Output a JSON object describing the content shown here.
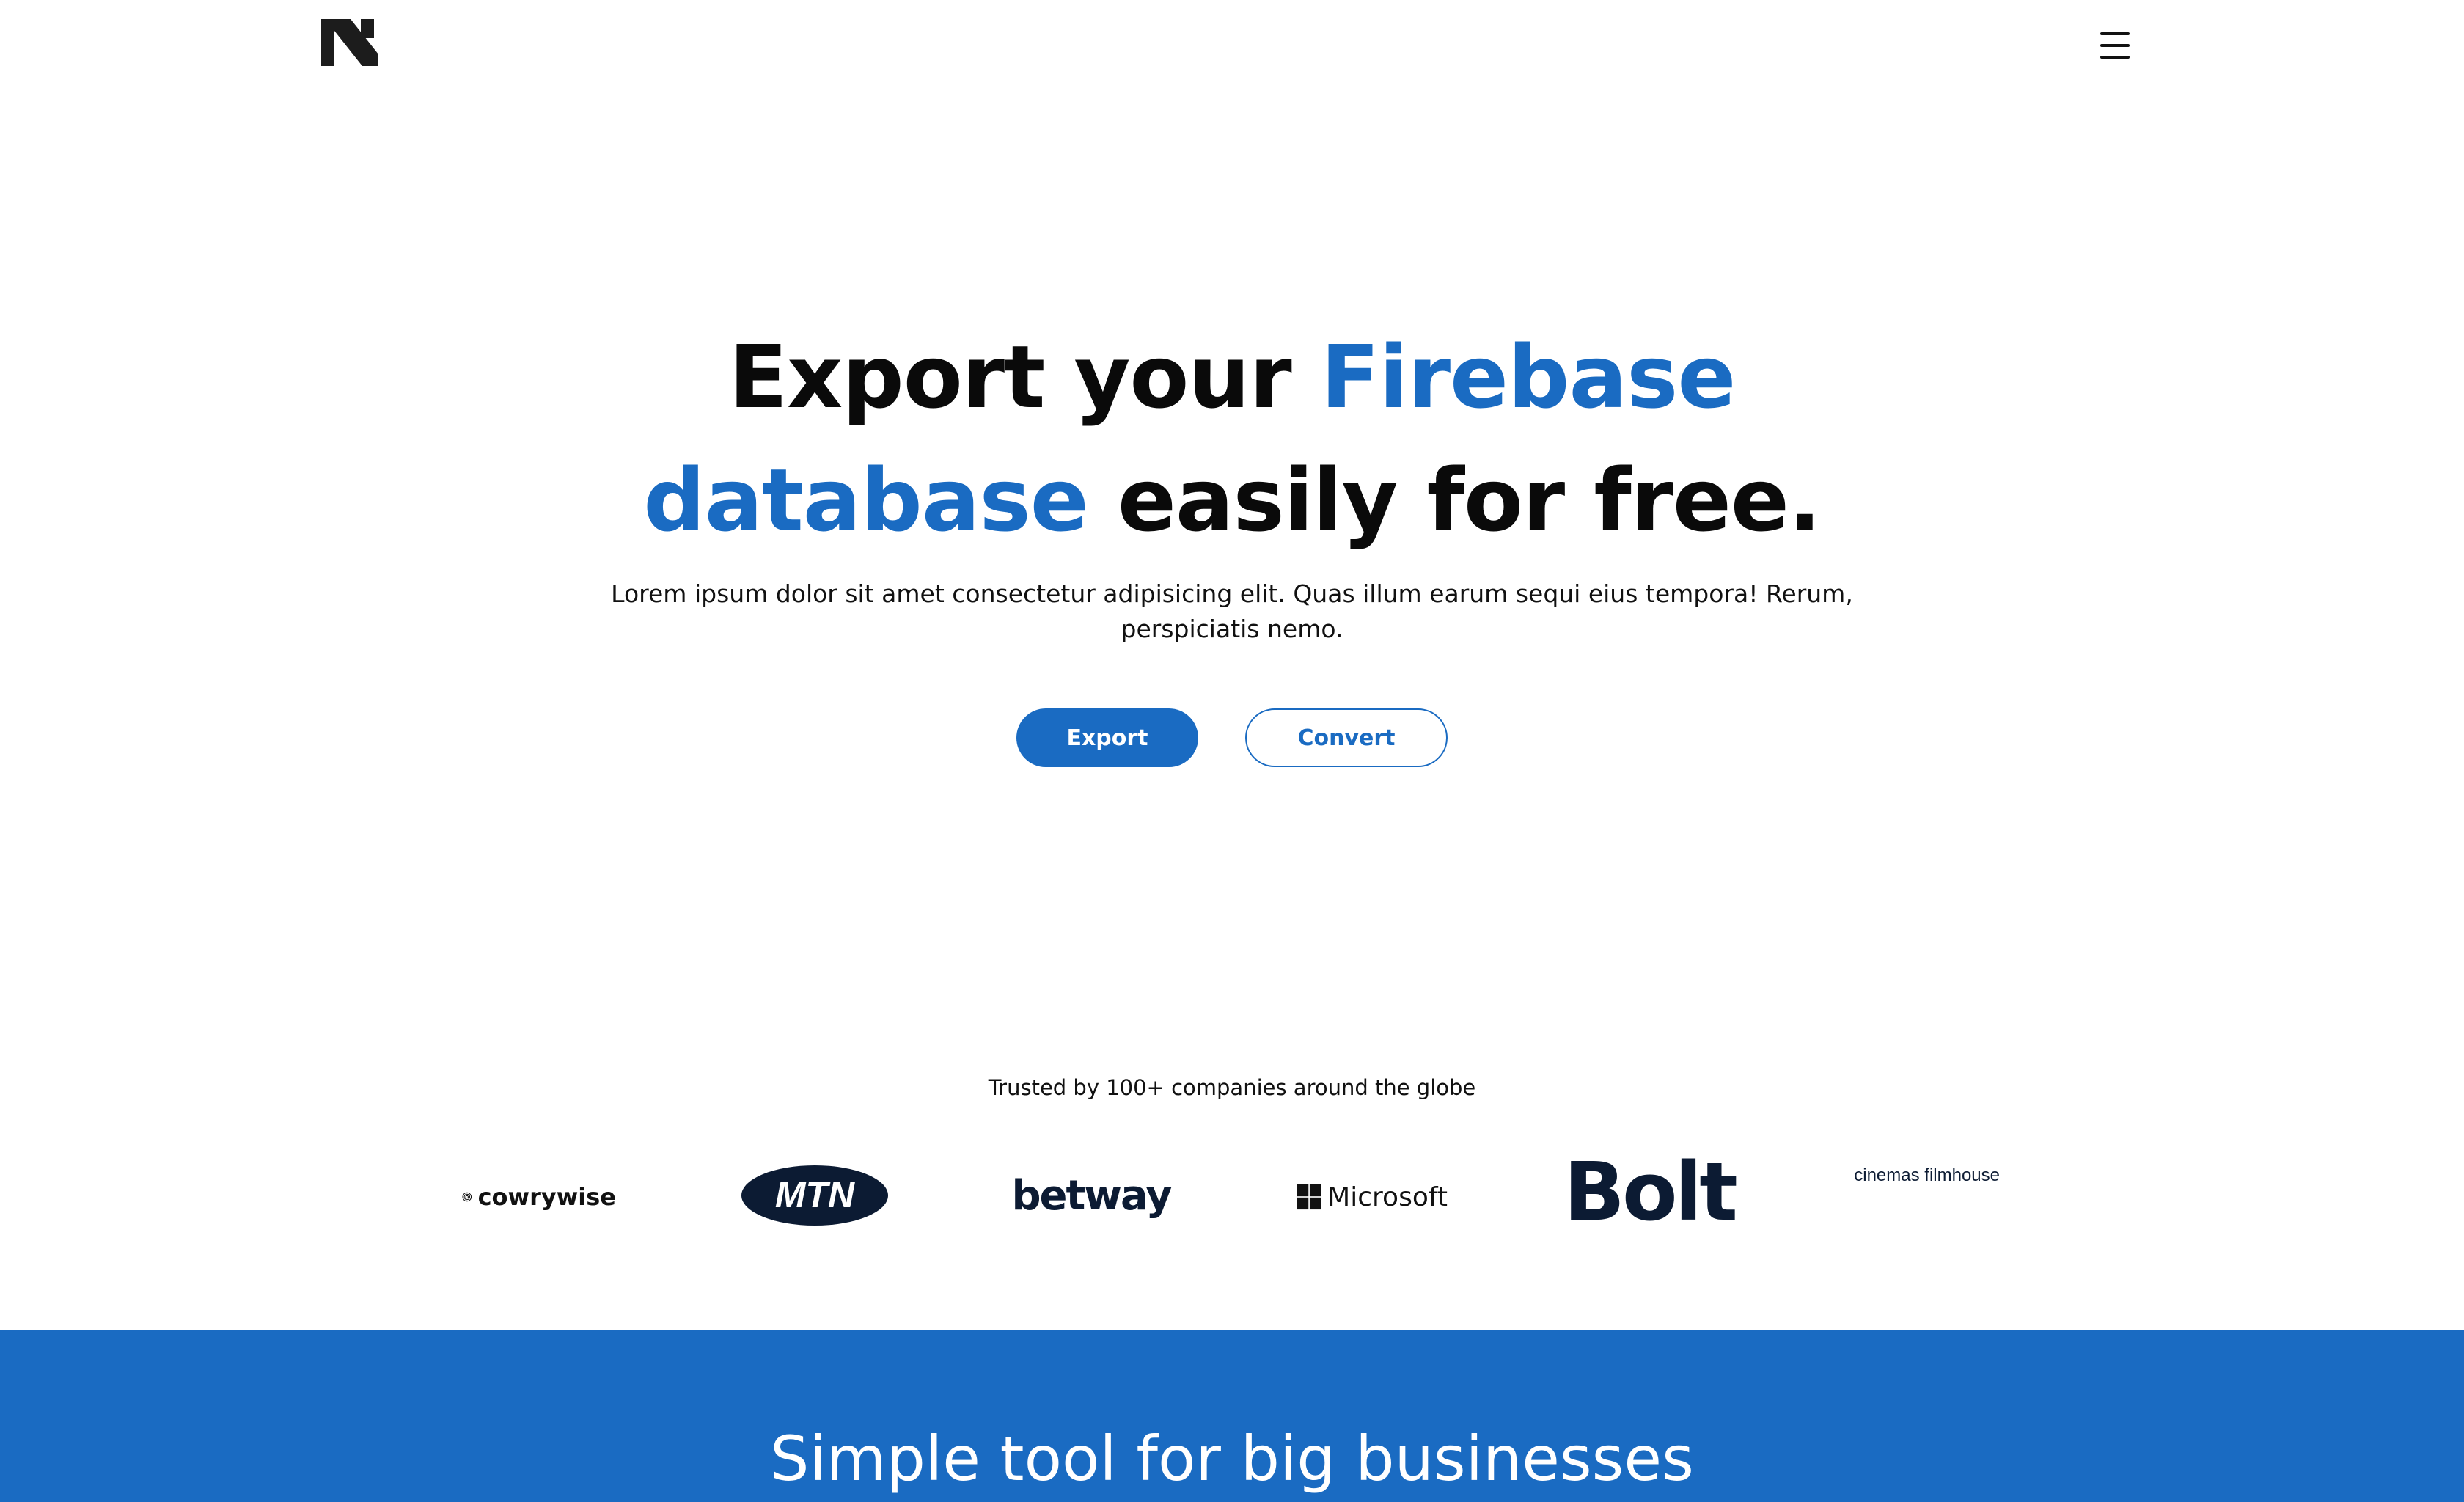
{
  "nav": {
    "logo_icon": "brand-n-logo",
    "menu_icon": "hamburger-menu-icon"
  },
  "hero": {
    "title_word1": "Export your ",
    "title_accent1": "Firebase",
    "title_accent2": "database",
    "title_word2": " easily for free.",
    "description": "Lorem ipsum dolor sit amet consectetur adipisicing elit. Quas illum earum sequi eius tempora! Rerum, perspiciatis nemo.",
    "export_label": "Export",
    "convert_label": "Convert"
  },
  "trusted": {
    "text": "Trusted by 100+ companies around the globe",
    "logos": [
      "cowrywise",
      "MTN",
      "betway",
      "Microsoft",
      "Bolt",
      "cinemas filmhouse"
    ]
  },
  "band": {
    "title": "Simple tool for big businesses"
  },
  "colors": {
    "accent": "#1a6bc2",
    "text": "#0a0a0a",
    "background": "#ffffff"
  }
}
